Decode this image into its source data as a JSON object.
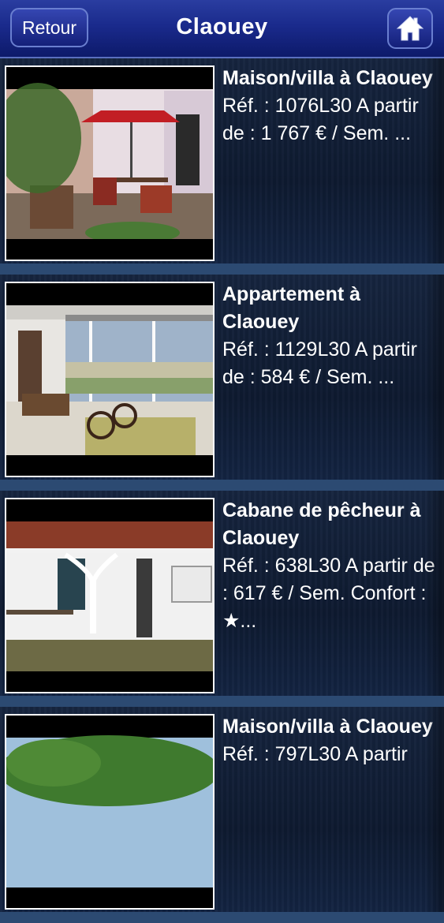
{
  "header": {
    "back_label": "Retour",
    "title": "Claouey",
    "home_icon": "home-icon"
  },
  "listings": [
    {
      "name": "Maison/villa à Claouey",
      "description": "Réf. : 1076L30 A partir de : 1 767 € / Sem. ..."
    },
    {
      "name": "Appartement à Claouey",
      "description": "Réf. : 1129L30 A partir de : 584 € / Sem. ..."
    },
    {
      "name": "Cabane de pêcheur à Claouey",
      "description": "Réf. : 638L30 A partir de : 617 € / Sem. Confort : ★..."
    },
    {
      "name": "Maison/villa à Claouey",
      "description": "Réf. : 797L30 A partir"
    }
  ]
}
